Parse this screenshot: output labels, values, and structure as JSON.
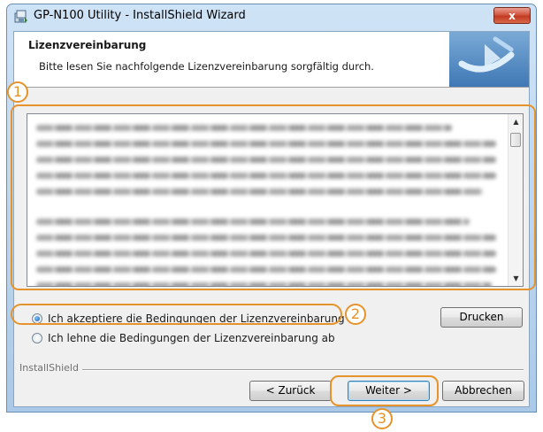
{
  "window": {
    "title": "GP-N100 Utility - InstallShield Wizard",
    "close_label": "x"
  },
  "header": {
    "title": "Lizenzvereinbarung",
    "subtitle": "Bitte lesen Sie nachfolgende Lizenzvereinbarung sorgfältig durch."
  },
  "options": {
    "accept_label": "Ich akzeptiere die Bedingungen der Lizenzvereinbarung",
    "accept_selected": true,
    "decline_label": "Ich lehne die Bedingungen der Lizenzvereinbarung ab",
    "decline_selected": false
  },
  "buttons": {
    "print": "Drucken",
    "back": "< Zurück",
    "next": "Weiter >",
    "cancel": "Abbrechen"
  },
  "footer": {
    "brand": "InstallShield"
  },
  "annotations": {
    "callout_1": "1",
    "callout_2": "2",
    "callout_3": "3"
  },
  "colors": {
    "highlight": "#e6932b",
    "close_button": "#c23a22",
    "header_logo": "#5a8fc4"
  },
  "icons": {
    "app": "installer-icon",
    "header_logo": "installshield-logo-icon",
    "scroll_up": "chevron-up-icon",
    "scroll_down": "chevron-down-icon"
  }
}
